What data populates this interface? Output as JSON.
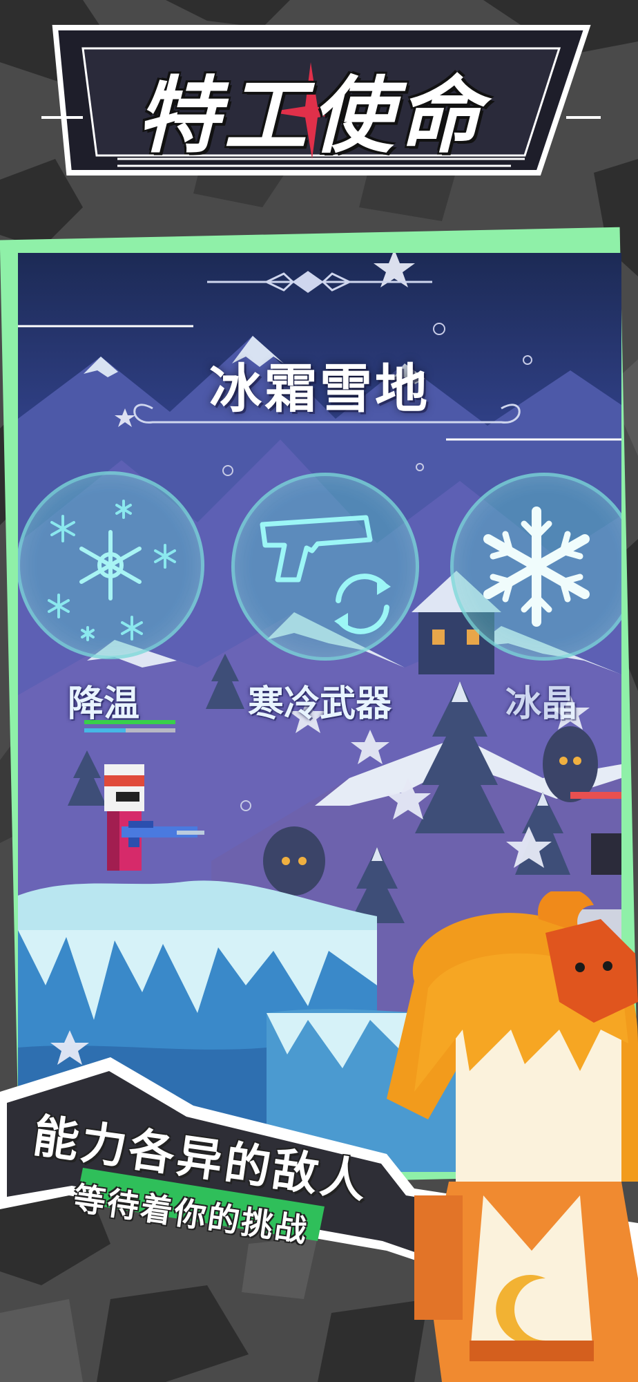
{
  "game": {
    "logo_title": "特工使命"
  },
  "level": {
    "title": "冰霜雪地"
  },
  "skills": [
    {
      "name": "降温",
      "icon": "snowflakes-icon"
    },
    {
      "name": "寒冷武器",
      "icon": "pistol-reload-icon"
    },
    {
      "name": "冰晶",
      "icon": "ice-crystal-icon"
    }
  ],
  "promo": {
    "headline": "能力各异的敌人",
    "subline": "等待着你的挑战"
  },
  "colors": {
    "card_border": "#8ff0a8",
    "skill_circle": "#5ac8c8",
    "subline_highlight": "#2fbf5a",
    "health_bar": "#38d04a",
    "shield_bar": "#46b8e6"
  }
}
